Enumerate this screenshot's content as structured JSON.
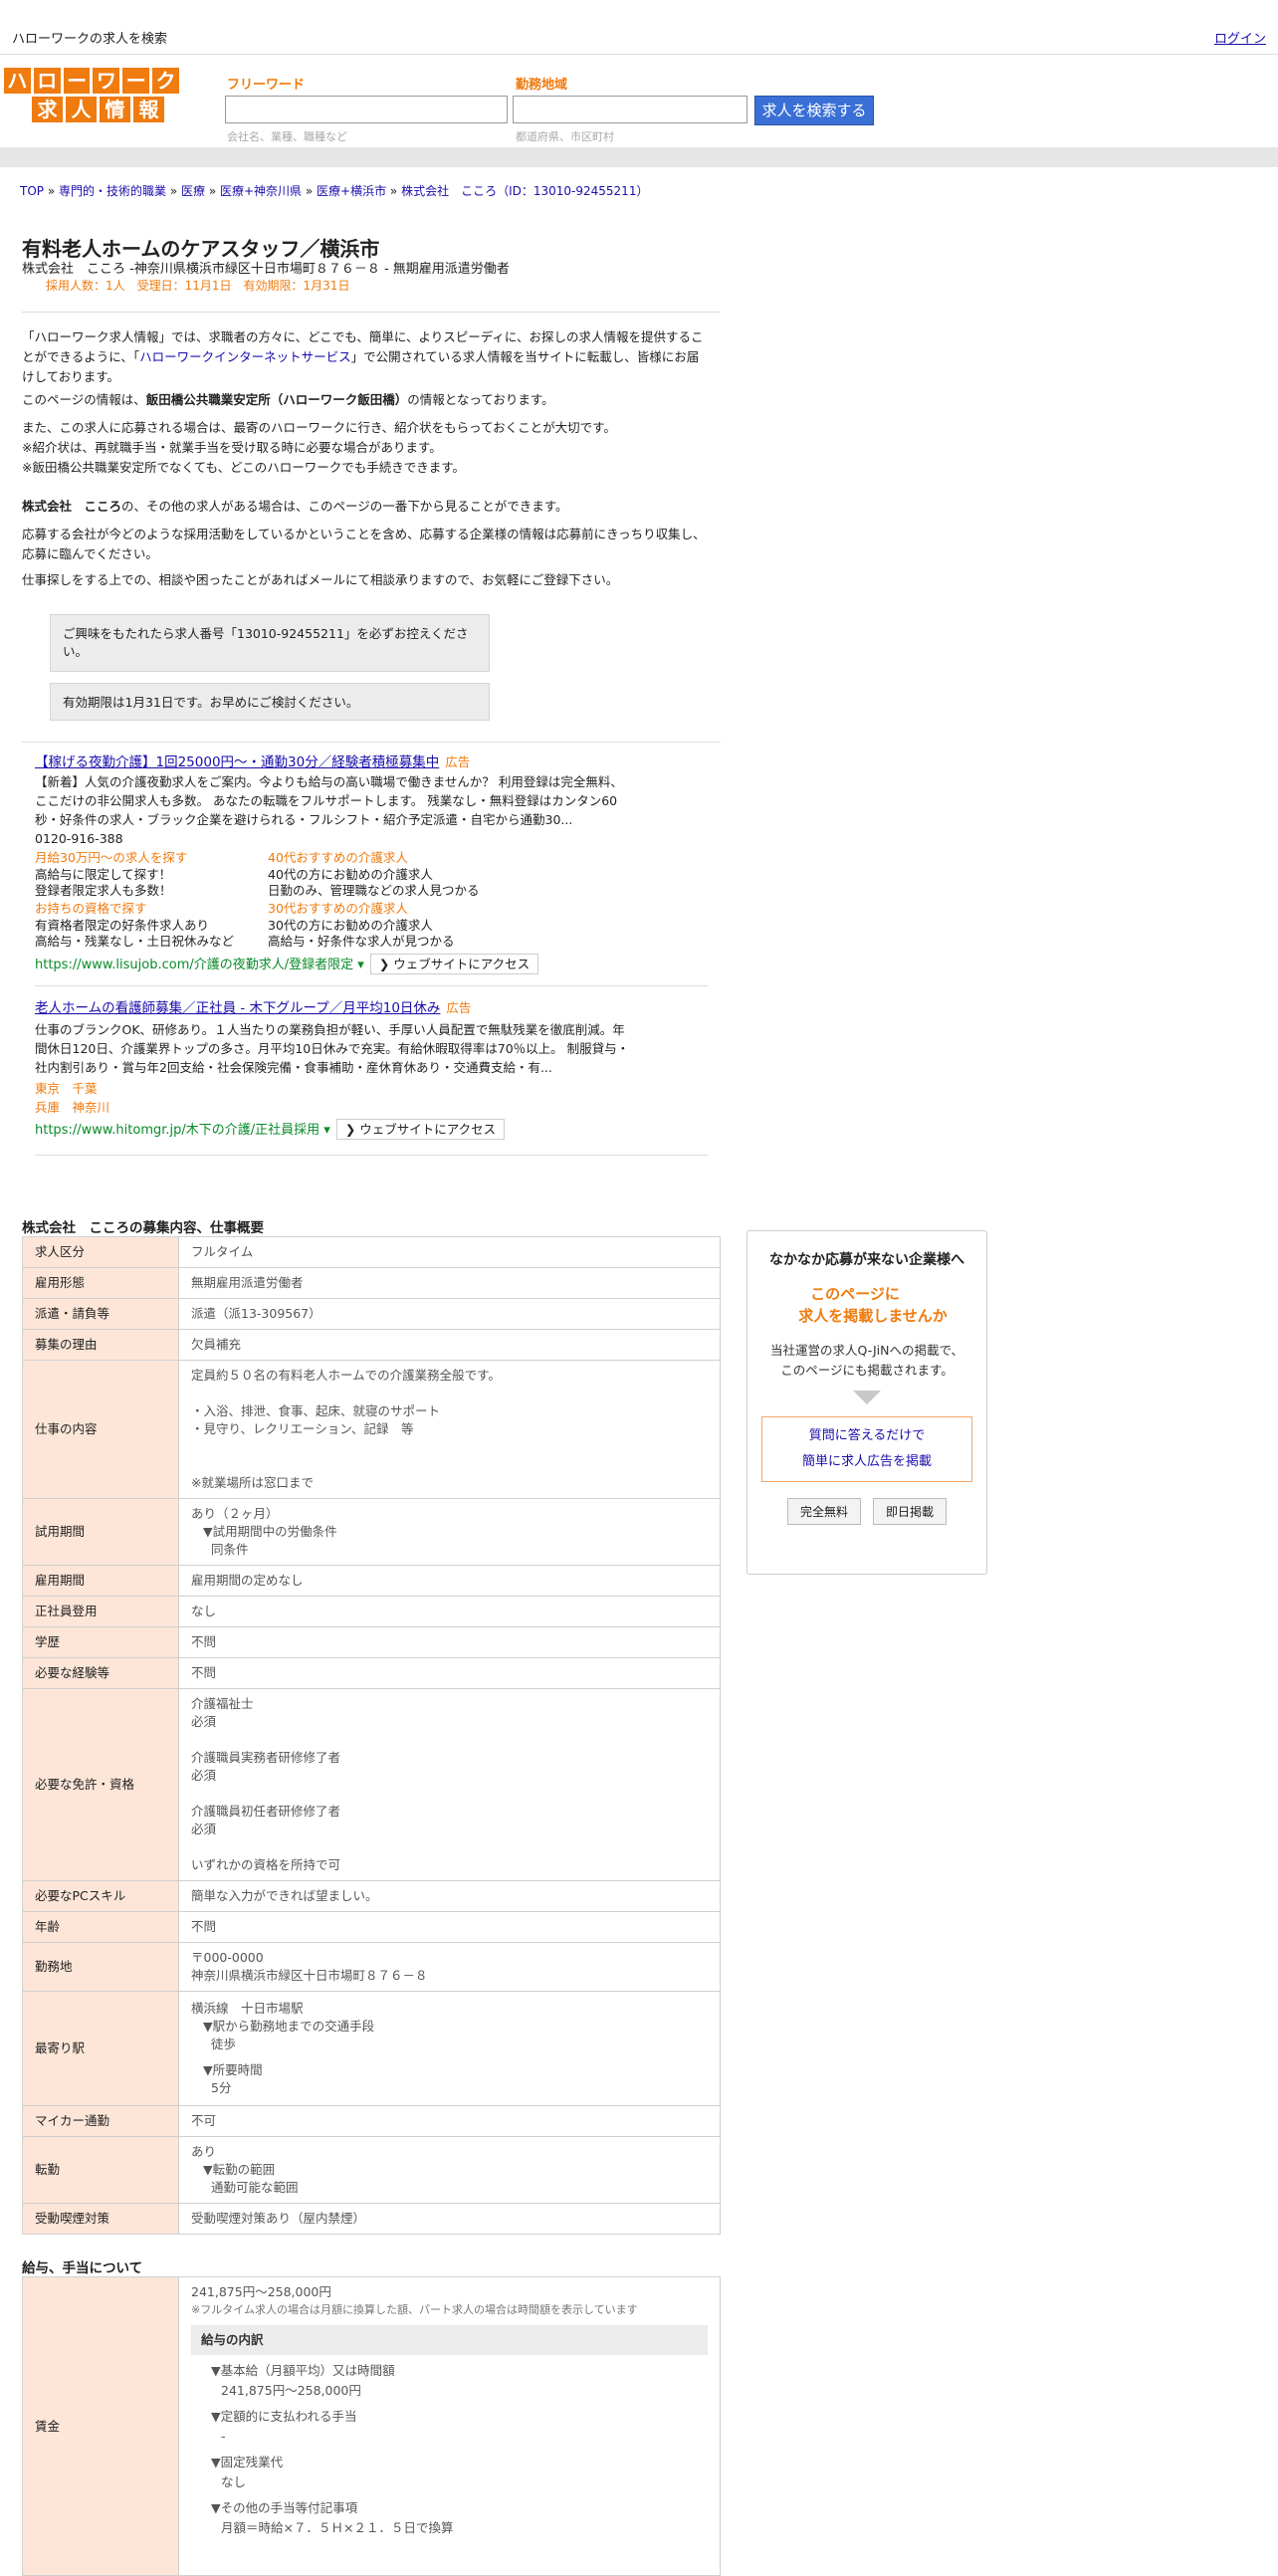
{
  "topbar": {
    "title": "ハローワークの求人を検索",
    "login": "ログイン"
  },
  "logo": {
    "row1": [
      "ハ",
      "ロ",
      "ー",
      "ワ",
      "ー",
      "ク"
    ],
    "row2": [
      "求",
      "人",
      "情",
      "報"
    ]
  },
  "search": {
    "keyword_label": "フリーワード",
    "keyword_hint": "会社名、業種、職種など",
    "area_label": "勤務地域",
    "area_hint": "都道府県、市区町村",
    "button": "求人を検索する"
  },
  "breadcrumb": [
    "TOP",
    "専門的・技術的職業",
    "医療",
    "医療+神奈川県",
    "医療+横浜市",
    "株式会社　こころ（ID：13010-92455211）"
  ],
  "job": {
    "title": "有料老人ホームのケアスタッフ／横浜市",
    "company_line": "株式会社　こころ -神奈川県横浜市緑区十日市場町８７６－８ - 無期雇用派遣労働者",
    "meta": "採用人数：1人　受理日：11月1日　有効期限：1月31日"
  },
  "intro": {
    "p1a": "「ハローワーク求人情報」では、求職者の方々に、どこでも、簡単に、よりスピーディに、お探しの求人情報を提供することができるように、「",
    "p1link": "ハローワークインターネットサービス",
    "p1b": "」で公開されている求人情報を当サイトに転載し、皆様にお届けしております。",
    "p2a": "このページの情報は、",
    "p2b": "飯田橋公共職業安定所（ハローワーク飯田橋）",
    "p2c": "の情報となっております。",
    "p3": "また、この求人に応募される場合は、最寄のハローワークに行き、紹介状をもらっておくことが大切です。",
    "p4": "※紹介状は、再就職手当・就業手当を受け取る時に必要な場合があります。",
    "p5": "※飯田橋公共職業安定所でなくても、どこのハローワークでも手続きできます。",
    "p6a": "株式会社　こころ",
    "p6b": "の、その他の求人がある場合は、このページの一番下から見ることができます。",
    "p7": "応募する会社が今どのような採用活動をしているかということを含め、応募する企業様の情報は応募前にきっちり収集し、応募に臨んでください。",
    "p8": "仕事探しをする上での、相談や困ったことがあればメールにて相談承りますので、お気軽にご登録下さい。"
  },
  "notes": {
    "n1": "ご興味をもたれたら求人番号「13010-92455211」を必ずお控えください。",
    "n2": "有効期限は1月31日です。お早めにご検討ください。"
  },
  "ads": {
    "a1": {
      "title": "【稼げる夜勤介護】1回25000円～・通勤30分／経験者積極募集中",
      "tag": "広告",
      "body": "【新着】人気の介護夜勤求人をご案内。今よりも給与の高い職場で働きませんか？ 利用登録は完全無料、ここだけの非公開求人も多数。 あなたの転職をフルサポートします。 残業なし・無料登録はカンタン60秒・好条件の求人・ブラック企業を避けられる・フルシフト・紹介予定派遣・自宅から通勤30...",
      "phone": "0120-916-388",
      "c1h": "月給30万円～の求人を探す",
      "c1a": "高給与に限定して探す！",
      "c1b": "登録者限定求人も多数！",
      "c2h": "40代おすすめの介護求人",
      "c2a": "40代の方にお勧めの介護求人",
      "c2b": "日勤のみ、管理職などの求人見つかる",
      "c3h": "お持ちの資格で探す",
      "c3a": "有資格者限定の好条件求人あり",
      "c3b": "高給与・残業なし・土日祝休みなど",
      "c4h": "30代おすすめの介護求人",
      "c4a": "30代の方にお勧めの介護求人",
      "c4b": "高給与・好条件な求人が見つかる",
      "url": "https://www.lisujob.com/介護の夜勤求人/登録者限定",
      "btn": "❯ ウェブサイトにアクセス"
    },
    "a2": {
      "title": "老人ホームの看護師募集／正社員 - 木下グループ／月平均10日休み",
      "tag": "広告",
      "body": "仕事のブランクOK、研修あり。１人当たりの業務負担が軽い、手厚い人員配置で無駄残業を徹底削減。年間休日120日、介護業界トップの多さ。月平均10日休みで充実。有給休暇取得率は70％以上。 制服貸与・社内割引あり・賞与年2回支給・社会保険完備・食事補助・産休育休あり・交通費支給・有...",
      "loc1": "東京　千葉",
      "loc2": "兵庫　神奈川",
      "url": "https://www.hitomgr.jp/木下の介護/正社員採用",
      "btn": "❯ ウェブサイトにアクセス"
    }
  },
  "section1": {
    "title": "株式会社　こころの募集内容、仕事概要",
    "rows": [
      {
        "k": "求人区分",
        "v": "フルタイム"
      },
      {
        "k": "雇用形態",
        "v": "無期雇用派遣労働者"
      },
      {
        "k": "派遣・請負等",
        "v": "派遣（派13-309567）"
      },
      {
        "k": "募集の理由",
        "v": "欠員補充"
      },
      {
        "k": "仕事の内容",
        "v1": "定員約５０名の有料老人ホームでの介護業務全般です。",
        "v2": "・入浴、排泄、食事、起床、就寝のサポート",
        "v3": "・見守り、レクリエーション、記録　等",
        "v4": "※就業場所は窓口まで"
      },
      {
        "k": "試用期間",
        "v1": "あり（２ヶ月）",
        "v2": "▼試用期間中の労働条件",
        "v3": "同条件"
      },
      {
        "k": "雇用期間",
        "v": "雇用期間の定めなし"
      },
      {
        "k": "正社員登用",
        "v": "なし"
      },
      {
        "k": "学歴",
        "v": "不問"
      },
      {
        "k": "必要な経験等",
        "v": "不問"
      },
      {
        "k": "必要な免許・資格",
        "v1": "介護福祉士",
        "v2": "必須",
        "v3": "介護職員実務者研修修了者",
        "v4": "必須",
        "v5": "介護職員初任者研修修了者",
        "v6": "必須",
        "v7": "いずれかの資格を所持で可"
      },
      {
        "k": "必要なPCスキル",
        "v": "簡単な入力ができれば望ましい。"
      },
      {
        "k": "年齢",
        "v": "不問"
      },
      {
        "k": "勤務地",
        "v1": "〒000-0000",
        "v2": "神奈川県横浜市緑区十日市場町８７６－８"
      },
      {
        "k": "最寄り駅",
        "v1": "横浜線　十日市場駅",
        "v2": "▼駅から勤務地までの交通手段",
        "v3": "徒歩",
        "v4": "▼所要時間",
        "v5": "5分"
      },
      {
        "k": "マイカー通勤",
        "v": "不可"
      },
      {
        "k": "転勤",
        "v1": "あり",
        "v2": "▼転勤の範囲",
        "v3": "通勤可能な範囲"
      },
      {
        "k": "受動喫煙対策",
        "v": "受動喫煙対策あり（屋内禁煙）"
      }
    ]
  },
  "section2": {
    "title": "給与、手当について",
    "k": "賃金",
    "v1": "241,875円〜258,000円",
    "v2": "※フルタイム求人の場合は月額に換算した額、パート求人の場合は時間額を表示しています",
    "sub": "給与の内訳",
    "d1": "▼基本給（月額平均）又は時間額",
    "d2": "241,875円〜258,000円",
    "d3": "▼定額的に支払われる手当",
    "d4": "-",
    "d5": "▼固定残業代",
    "d6": "なし",
    "d7": "▼その他の手当等付記事項",
    "d8": "月額＝時給×７．５Ｈ×２１．５日で換算"
  },
  "sidebar": {
    "heading": "なかなか応募が来ない企業様へ",
    "offer1": "このページに",
    "offer2": "求人を掲載しませんか",
    "desc1": "当社運営の求人Q-JiNへの掲載で、",
    "desc2": "このページにも掲載されます。",
    "link1": "質問に答えるだけで",
    "link2": "簡単に求人広告を掲載",
    "btn1": "完全無料",
    "btn2": "即日掲載"
  }
}
